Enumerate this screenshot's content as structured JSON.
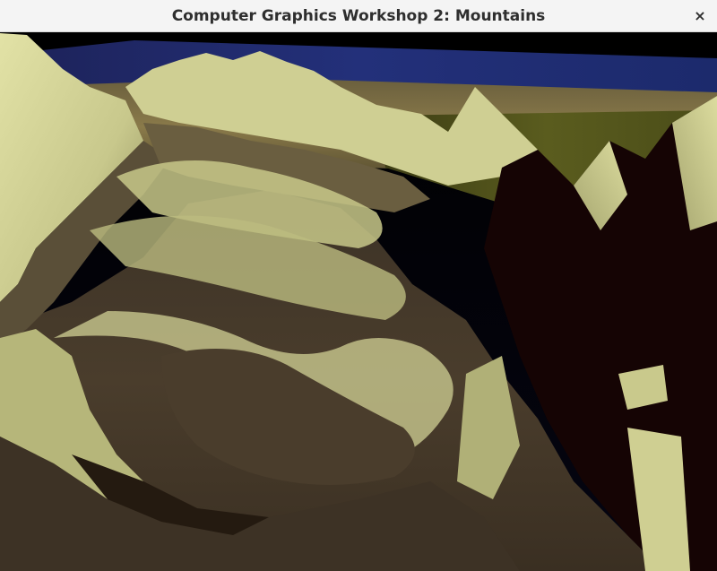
{
  "window": {
    "title": "Computer Graphics Workshop 2: Mountains",
    "close_glyph": "×",
    "close_icon": "close-icon"
  },
  "scene": {
    "description_icon": "rendered-terrain",
    "colors": {
      "sky_black": "#000000",
      "water_blue": "#1f2a6a",
      "sand": "#8a7a4a",
      "grass": "#55581c",
      "lit_rock": "#d8d89a",
      "valley": "#4a3d2c",
      "shadow": "#140303"
    }
  }
}
